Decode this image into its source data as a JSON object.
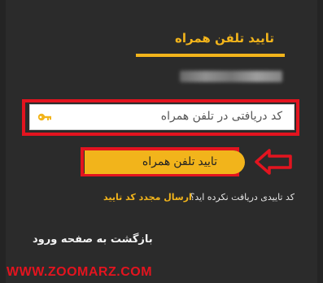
{
  "header": {
    "title": "تایید تلفن همراه"
  },
  "input": {
    "placeholder": "کد دریافتی در تلفن همراه",
    "icon": "key-icon"
  },
  "confirm_button": {
    "label": "تایید تلفن همراه"
  },
  "resend": {
    "question": "کد تاییدی دریافت نکرده اید؟",
    "link": "ارسال مجدد کد تایید"
  },
  "back_link": {
    "label": "بازگشت به صفحه ورود"
  },
  "watermark": {
    "text": "WWW.ZOOMARZ.COM"
  },
  "colors": {
    "accent": "#f2b41b",
    "annotation": "#e3141f",
    "background": "#2b2b2b"
  }
}
